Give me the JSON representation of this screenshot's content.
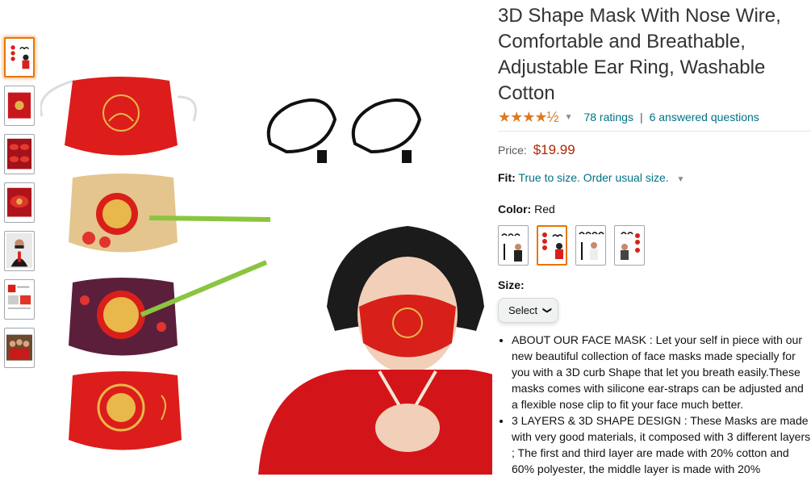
{
  "thumbnails": [
    {
      "label": "ear-straps and mask set",
      "selected": true
    },
    {
      "label": "red ox masks"
    },
    {
      "label": "red masks grid"
    },
    {
      "label": "red masks close-up"
    },
    {
      "label": "man wearing mask"
    },
    {
      "label": "mask layers info"
    },
    {
      "label": "group photo"
    }
  ],
  "product": {
    "title": "3D Shape Mask With Nose Wire, Comfortable and Breathable, Adjustable Ear Ring, Washable Cotton",
    "stars": "★★★★½",
    "ratings": "78 ratings",
    "separator": "|",
    "answered": "6 answered questions",
    "price_label": "Price:",
    "price": "$19.99",
    "fit_label": "Fit:",
    "fit_value": "True to size. Order usual size.",
    "color_label": "Color:",
    "color_value": "Red",
    "size_label": "Size:",
    "size_select": "Select",
    "bullets": [
      "ABOUT OUR FACE MASK : Let your self in piece with our new beautiful collection of face masks made specially for you with a 3D curb Shape that let you breath easily.These masks comes with silicone ear-straps can be adjusted and a flexible nose clip to fit your face much better.",
      "3 LAYERS & 3D SHAPE DESIGN : These Masks are made with very good materials, it composed with 3 different layers ; The first and third layer are made with 20% cotton and 60% polyester, the middle layer is made with 20%"
    ]
  },
  "colors": {
    "accent": "#e77600",
    "link": "#007185",
    "price": "#b12704",
    "star": "#de7921",
    "mask_red": "#d91f1a",
    "gold": "#e0b34a"
  }
}
